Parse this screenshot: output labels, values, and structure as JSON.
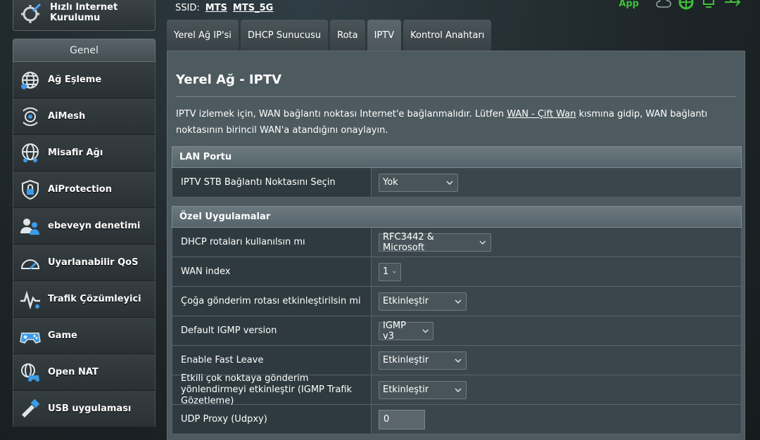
{
  "sidebar": {
    "quick_setup": "Hızlı Internet Kurulumu",
    "group_header": "Genel",
    "items": [
      {
        "label": "Ağ Eşleme",
        "icon": "network-map-icon"
      },
      {
        "label": "AiMesh",
        "icon": "aimesh-icon"
      },
      {
        "label": "Misafir Ağı",
        "icon": "guest-network-icon"
      },
      {
        "label": "AiProtection",
        "icon": "shield-lock-icon"
      },
      {
        "label": "ebeveyn denetimi",
        "icon": "parental-control-icon"
      },
      {
        "label": "Uyarlanabilir QoS",
        "icon": "speedometer-icon"
      },
      {
        "label": "Trafik Çözümleyici",
        "icon": "traffic-analyzer-icon"
      },
      {
        "label": "Game",
        "icon": "gamepad-icon"
      },
      {
        "label": "Open NAT",
        "icon": "open-nat-icon"
      },
      {
        "label": "USB uygulaması",
        "icon": "usb-icon"
      }
    ]
  },
  "topbar": {
    "ssid_label": "SSID:",
    "ssid_1": "MTS",
    "ssid_2": "MTS_5G",
    "app_label": "App"
  },
  "tabs": [
    {
      "label": "Yerel Ağ IP'si",
      "active": false
    },
    {
      "label": "DHCP Sunucusu",
      "active": false
    },
    {
      "label": "Rota",
      "active": false
    },
    {
      "label": "IPTV",
      "active": true
    },
    {
      "label": "Kontrol Anahtarı",
      "active": false
    }
  ],
  "main": {
    "title": "Yerel Ağ - IPTV",
    "intro_before": "IPTV izlemek için, WAN bağlantı noktası Internet'e bağlanmalıdır. Lütfen ",
    "intro_link": "WAN - Çift Wan",
    "intro_after": " kısmına gidip, WAN bağlantı noktasının birincil WAN'a atandığını onaylayın.",
    "lan_section": {
      "header": "LAN Portu",
      "stb_label": "IPTV STB Bağlantı Noktasını Seçin",
      "stb_value": "Yok"
    },
    "special_section": {
      "header": "Özel Uygulamalar",
      "dhcp_routes_label": "DHCP rotaları kullanılsın mı",
      "dhcp_routes_value": "RFC3442 & Microsoft",
      "wan_index_label": "WAN index",
      "wan_index_value": "1",
      "multicast_route_label": "Çoğa gönderim rotası etkinleştirilsin mi",
      "multicast_route_value": "Etkinleştir",
      "igmp_version_label": "Default IGMP version",
      "igmp_version_value": "IGMP v3",
      "fast_leave_label": "Enable Fast Leave",
      "fast_leave_value": "Etkinleştir",
      "igmp_snooping_label": "Etkili çok noktaya gönderim yönlendirmeyi etkinleştir (IGMP Trafik Gözetleme)",
      "igmp_snooping_value": "Etkinleştir",
      "udp_proxy_label": "UDP Proxy (Udpxy)",
      "udp_proxy_value": "0"
    }
  }
}
